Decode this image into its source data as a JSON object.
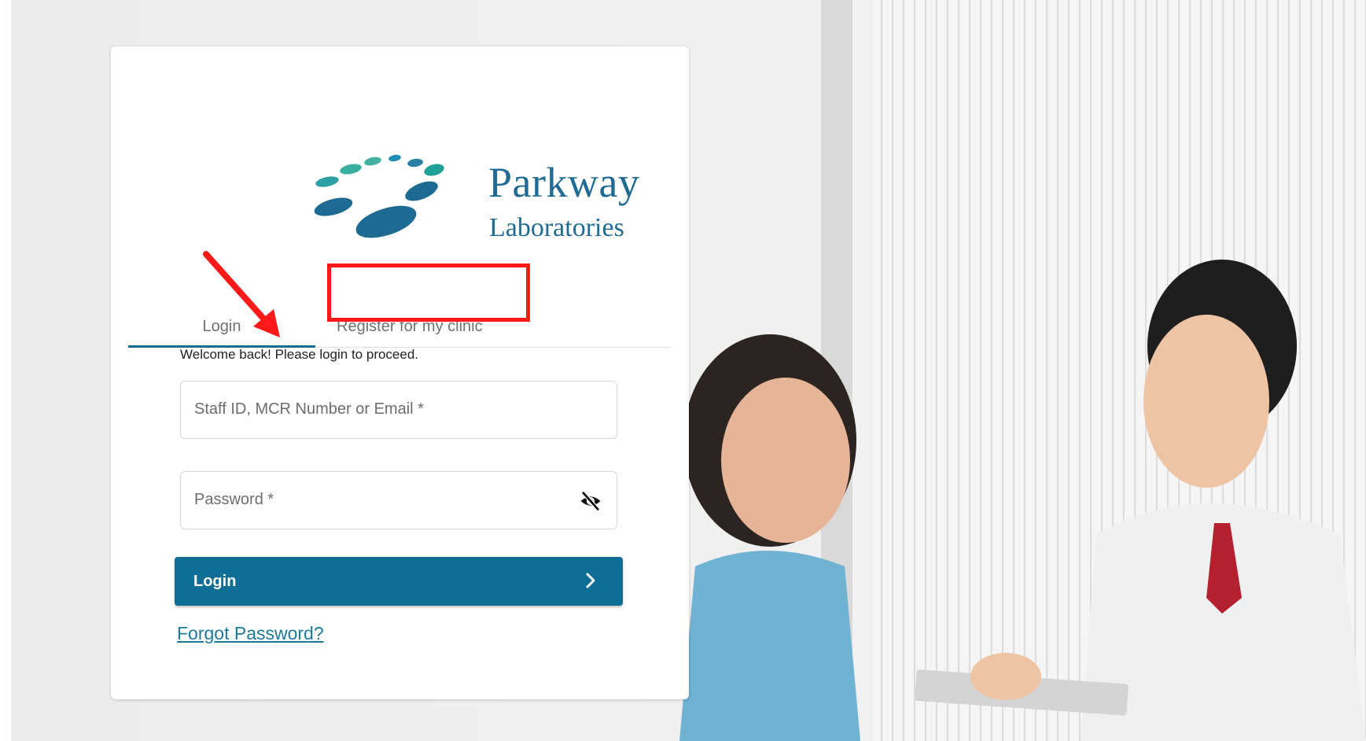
{
  "brand": {
    "name": "Parkway",
    "subtitle": "Laboratories"
  },
  "tabs": [
    {
      "label": "Login",
      "active": true
    },
    {
      "label": "Register for my clinic",
      "active": false
    }
  ],
  "form": {
    "welcome_text": "Welcome back! Please login to proceed.",
    "id_placeholder": "Staff ID, MCR Number or Email *",
    "password_placeholder": "Password *",
    "login_label": "Login",
    "forgot_label": "Forgot Password?"
  },
  "colors": {
    "primary": "#0f6e95",
    "brand": "#1f6b93",
    "highlight": "#ff1a1a"
  },
  "icons": {
    "password_toggle": "eye-off-icon",
    "login_chevron": "chevron-right-icon",
    "annotation": "arrow-icon"
  }
}
